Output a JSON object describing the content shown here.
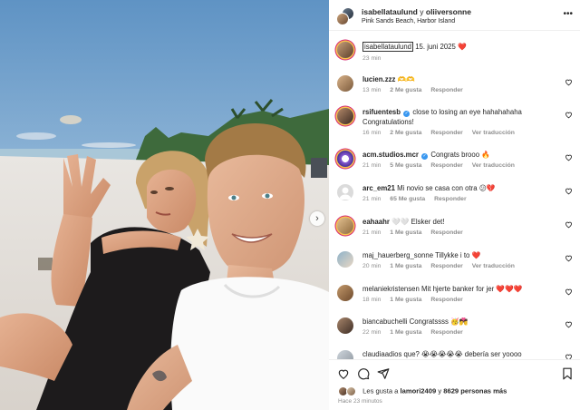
{
  "post": {
    "header": {
      "user1": "isabellataulund",
      "conjunction": "y",
      "user2": "oliiversonne",
      "location": "Pink Sands Beach, Harbor Island",
      "more_icon": "more-horizontal-icon"
    },
    "caption": {
      "username": "isabellataulund",
      "text": "15. juni 2025",
      "emoji": "❤️",
      "time": "23 min"
    },
    "photo": {
      "next_icon": "chevron-right-icon"
    }
  },
  "comments": [
    {
      "username": "lucien.zzz",
      "text": "🫶🫶",
      "time": "13 min",
      "likes": "2 Me gusta",
      "reply": "Responder"
    },
    {
      "username": "rsifuentesb",
      "verified": true,
      "text": "close to losing an eye hahahahaha",
      "text2": "Congratulations!",
      "time": "16 min",
      "likes": "2 Me gusta",
      "reply": "Responder",
      "translate": "Ver traducción"
    },
    {
      "username": "acm.studios.mcr",
      "verified": true,
      "text": "Congrats brooo 🔥",
      "time": "21 min",
      "likes": "5 Me gusta",
      "reply": "Responder",
      "translate": "Ver traducción"
    },
    {
      "username": "arc_em21",
      "text": "Mi novio se casa con otra 😕💔",
      "time": "21 min",
      "likes": "65 Me gusta",
      "reply": "Responder"
    },
    {
      "username": "eahaahr",
      "text": "🤍🤍 Elsker det!",
      "time": "21 min",
      "likes": "1 Me gusta",
      "reply": "Responder"
    },
    {
      "username": "maj_hauerberg_sonne",
      "text": "Tillykke i to ❤️",
      "time": "20 min",
      "likes": "1 Me gusta",
      "reply": "Responder",
      "translate": "Ver traducción"
    },
    {
      "username": "melaniekristensen",
      "text": "Mit hjerte banker for jer ❤️❤️❤️",
      "time": "18 min",
      "likes": "1 Me gusta",
      "reply": "Responder"
    },
    {
      "username": "biancabuchelli",
      "text": "Congratssss 🥳💏",
      "time": "22 min",
      "likes": "1 Me gusta",
      "reply": "Responder"
    },
    {
      "username": "claudiaadios",
      "text": "que? 😭😭😭😭😭 debería ser yoooo"
    }
  ],
  "footer": {
    "liked_prefix": "Les gusta a",
    "liked_user": "lamori2409",
    "liked_mid": "y",
    "liked_count": "8629 personas más",
    "posted_ago": "Hace 23 minutos",
    "icons": [
      "heart-icon",
      "comment-icon",
      "share-icon",
      "bookmark-icon"
    ]
  },
  "colors": {
    "like_red": "#ed4956",
    "verified_blue": "#3897f0",
    "muted_gray": "#8e8e8e",
    "story_ring": "#d62976"
  }
}
